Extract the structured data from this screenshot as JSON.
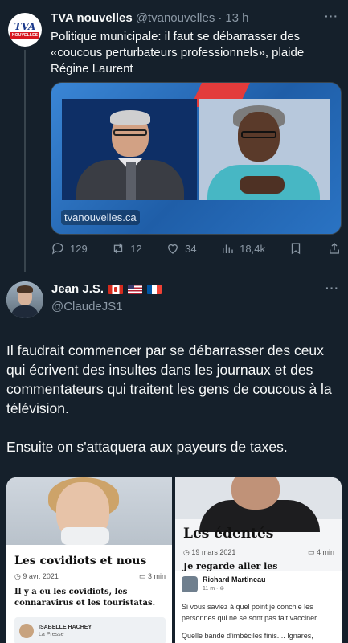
{
  "parent_tweet": {
    "avatar_logo": "TVA",
    "avatar_sub": "NOUVELLES",
    "name": "TVA nouvelles",
    "handle": "@tvanouvelles",
    "separator": "·",
    "time": "13 h",
    "text": "Politique municipale: il faut se débarrasser des «coucous perturbateurs professionnels», plaide Régine Laurent",
    "card_domain": "tvanouvelles.ca",
    "actions": {
      "replies": "129",
      "retweets": "12",
      "likes": "34",
      "views": "18,4k"
    }
  },
  "reply_tweet": {
    "name": "Jean J.S.",
    "handle": "@ClaudeJS1",
    "flags": [
      "flag-canada",
      "flag-usa",
      "flag-france"
    ],
    "text_p1": "Il faudrait commencer par se débarrasser des ceux qui écrivent des insultes dans les journaux et des commentateurs qui traitent les gens de coucous à la télévision.",
    "text_p2": "Ensuite on s'attaquera aux payeurs de taxes."
  },
  "media": {
    "article1": {
      "title": "Les covidiots et nous",
      "date": "9 avr. 2021",
      "read_time": "3 min",
      "lede": "Il y a eu les covidiots, les connaravirus et les touristatas.",
      "byline_name": "ISABELLE HACHEY",
      "byline_org": "La Presse"
    },
    "article2": {
      "title": "Les édentés",
      "date": "19 mars 2021",
      "read_time": "4 min",
      "cut_text": "Je regarde aller les"
    },
    "article3": {
      "name": "Richard Martineau",
      "meta": "11 m · ⊛",
      "text_p1": "Si vous saviez à quel point je conchie les personnes qui ne se sont pas fait vacciner...",
      "text_p2": "Quelle bande d'imbéciles finis.... Ignares,"
    }
  },
  "colors": {
    "background": "#15202b",
    "text": "#f7f9f9",
    "muted": "#8b98a5"
  }
}
